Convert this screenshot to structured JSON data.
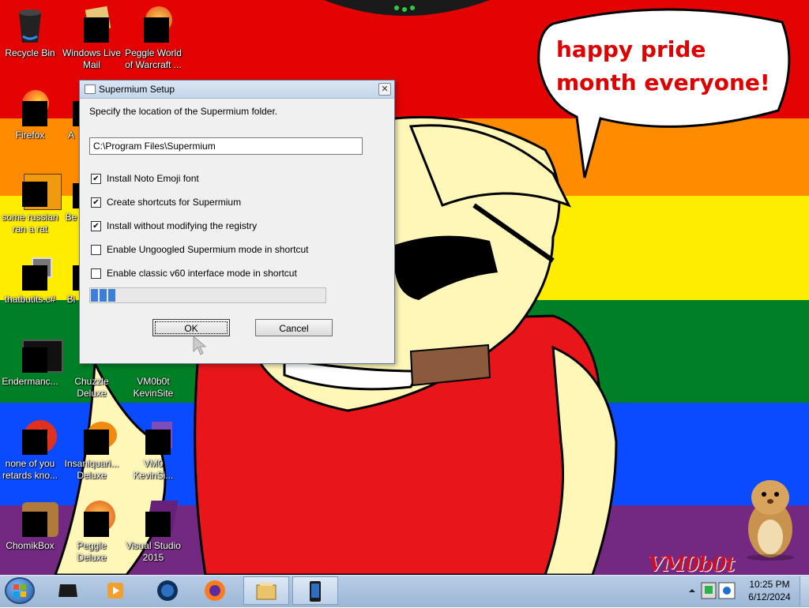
{
  "desktop": {
    "bubble_text": "happy pride month everyone!",
    "signature": "VM0b0t",
    "icons": [
      {
        "label": "Recycle Bin",
        "icon": "recycle-bin-icon"
      },
      {
        "label": "Windows Live Mail",
        "icon": "windows-live-mail-icon"
      },
      {
        "label": "Peggle World of Warcraft ...",
        "icon": "peggle-wow-icon"
      },
      {
        "label": "Firefox",
        "icon": "firefox-icon"
      },
      {
        "label": "A",
        "icon": "app-icon"
      },
      {
        "label": "some russian ran a rat",
        "icon": "game-icon"
      },
      {
        "label": "Be",
        "icon": "app-icon"
      },
      {
        "label": "thatbutits.c#",
        "icon": "shortcut-icon"
      },
      {
        "label": "Bi",
        "icon": "app-icon"
      },
      {
        "label": "Endermanc...",
        "icon": "terminal-icon"
      },
      {
        "label": "Chuzzle Deluxe",
        "icon": "chuzzle-icon"
      },
      {
        "label": "VM0b0t KevinSite",
        "icon": "site-icon"
      },
      {
        "label": "none of you retards kno...",
        "icon": "chrome-like-icon"
      },
      {
        "label": "Insaniquari... Deluxe",
        "icon": "insaniquarium-icon"
      },
      {
        "label": "VM0 KevinSi...",
        "icon": "site-icon"
      },
      {
        "label": "ChomikBox",
        "icon": "chomikbox-icon"
      },
      {
        "label": "Peggle Deluxe",
        "icon": "peggle-icon"
      },
      {
        "label": "Visual Studio 2015",
        "icon": "visual-studio-icon"
      }
    ]
  },
  "dialog": {
    "title": "Supermium Setup",
    "close_glyph": "✕",
    "prompt": "Specify the location of the Supermium folder.",
    "path_value": "C:\\Program Files\\Supermium",
    "options": [
      {
        "label": "Install Noto Emoji font",
        "checked": true
      },
      {
        "label": "Create shortcuts for Supermium",
        "checked": true
      },
      {
        "label": "Install without modifying the registry",
        "checked": true
      },
      {
        "label": "Enable Ungoogled Supermium mode in shortcut",
        "checked": false
      },
      {
        "label": "Enable classic v60 interface mode in shortcut",
        "checked": false
      }
    ],
    "progress_fraction": 0.12,
    "ok_label": "OK",
    "cancel_label": "Cancel"
  },
  "taskbar": {
    "items": [
      {
        "icon": "media-center-icon"
      },
      {
        "icon": "media-player-icon"
      },
      {
        "icon": "globe-icon"
      },
      {
        "icon": "firefox-icon"
      },
      {
        "icon": "explorer-window-icon",
        "active": true
      },
      {
        "icon": "phone-window-icon",
        "active": true
      }
    ],
    "clock_time": "10:25 PM",
    "clock_date": "6/12/2024"
  }
}
